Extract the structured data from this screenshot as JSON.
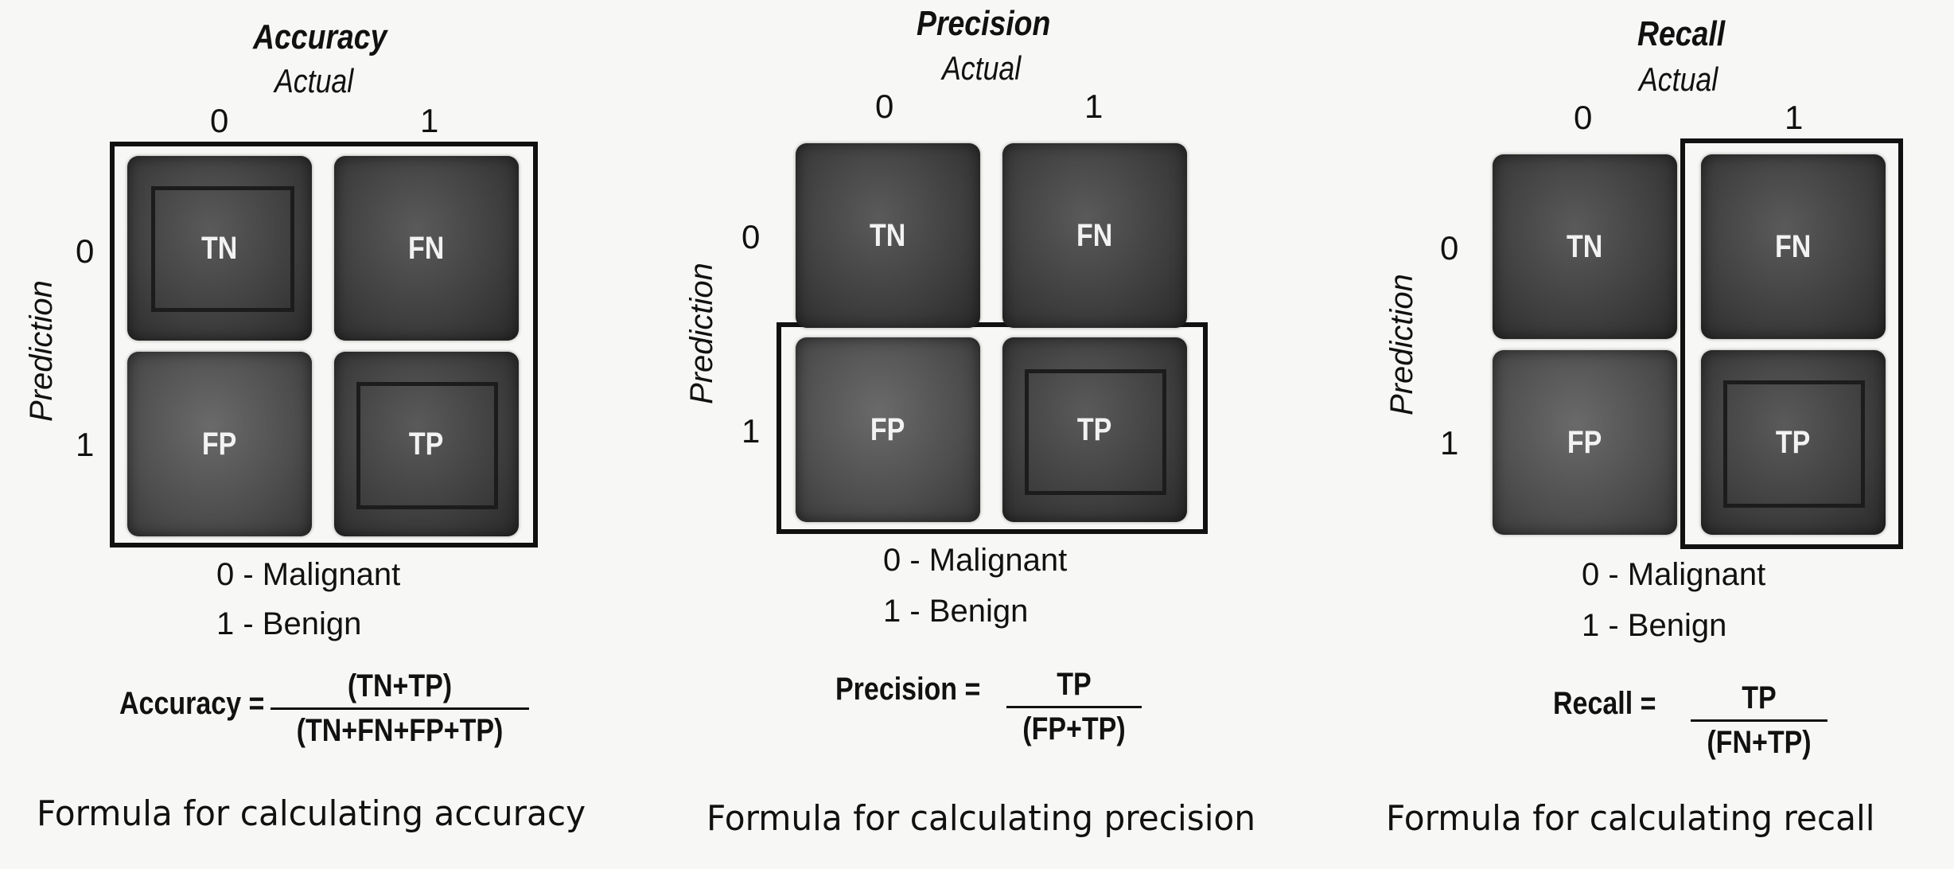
{
  "panels": [
    {
      "title": "Accuracy",
      "actual_label": "Actual",
      "actual_ticks": [
        "0",
        "1"
      ],
      "prediction_label": "Prediction",
      "prediction_ticks": [
        "0",
        "1"
      ],
      "cells": [
        "TN",
        "FN",
        "FP",
        "TP"
      ],
      "legend": [
        "0 - Malignant",
        "1 - Benign"
      ],
      "formula_lhs": "Accuracy =",
      "formula_num": "(TN+TP)",
      "formula_den": "(TN+FN+FP+TP)",
      "caption": "Formula for calculating accuracy"
    },
    {
      "title": "Precision",
      "actual_label": "Actual",
      "actual_ticks": [
        "0",
        "1"
      ],
      "prediction_label": "Prediction",
      "prediction_ticks": [
        "0",
        "1"
      ],
      "cells": [
        "TN",
        "FN",
        "FP",
        "TP"
      ],
      "legend": [
        "0 - Malignant",
        "1 - Benign"
      ],
      "formula_lhs": "Precision =",
      "formula_num": "TP",
      "formula_den": "(FP+TP)",
      "caption": "Formula for calculating precision"
    },
    {
      "title": "Recall",
      "actual_label": "Actual",
      "actual_ticks": [
        "0",
        "1"
      ],
      "prediction_label": "Prediction",
      "prediction_ticks": [
        "0",
        "1"
      ],
      "cells": [
        "TN",
        "FN",
        "FP",
        "TP"
      ],
      "legend": [
        "0 - Malignant",
        "1 - Benign"
      ],
      "formula_lhs": "Recall =",
      "formula_num": "TP",
      "formula_den": "(FN+TP)",
      "caption": "Formula for calculating recall"
    }
  ]
}
